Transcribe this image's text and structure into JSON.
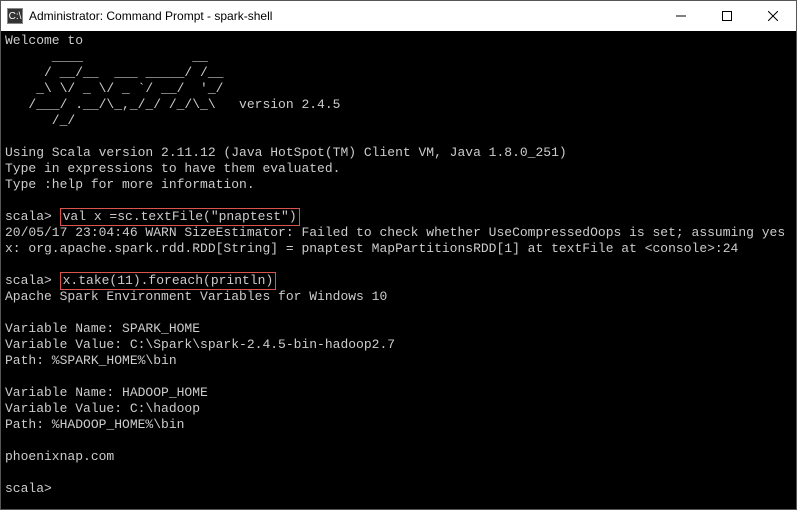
{
  "titlebar": {
    "icon_label": "C:\\",
    "title": "Administrator: Command Prompt - spark-shell"
  },
  "t": {
    "welcome": "Welcome to",
    "ascii1": "      ____              __",
    "ascii2": "     / __/__  ___ _____/ /__",
    "ascii3": "    _\\ \\/ _ \\/ _ `/ __/  '_/",
    "ascii4": "   /___/ .__/\\_,_/_/ /_/\\_\\   version 2.4.5",
    "ascii5": "      /_/",
    "blank": "",
    "scala_ver": "Using Scala version 2.11.12 (Java HotSpot(TM) Client VM, Java 1.8.0_251)",
    "type_expr": "Type in expressions to have them evaluated.",
    "type_help": "Type :help for more information.",
    "prompt": "scala> ",
    "cmd1": "val x =sc.textFile(\"pnaptest\")",
    "warn": "20/05/17 23:04:46 WARN SizeEstimator: Failed to check whether UseCompressedOops is set; assuming yes",
    "rdd": "x: org.apache.spark.rdd.RDD[String] = pnaptest MapPartitionsRDD[1] at textFile at <console>:24",
    "cmd2": "x.take(11).foreach(println)",
    "out_title": "Apache Spark Environment Variables for Windows 10",
    "vn_spark": "Variable Name: SPARK_HOME",
    "vv_spark": "Variable Value: C:\\Spark\\spark-2.4.5-bin-hadoop2.7",
    "path_spark": "Path: %SPARK_HOME%\\bin",
    "vn_hadoop": "Variable Name: HADOOP_HOME",
    "vv_hadoop": "Variable Value: C:\\hadoop",
    "path_hadoop": "Path: %HADOOP_HOME%\\bin",
    "site": "phoenixnap.com"
  }
}
